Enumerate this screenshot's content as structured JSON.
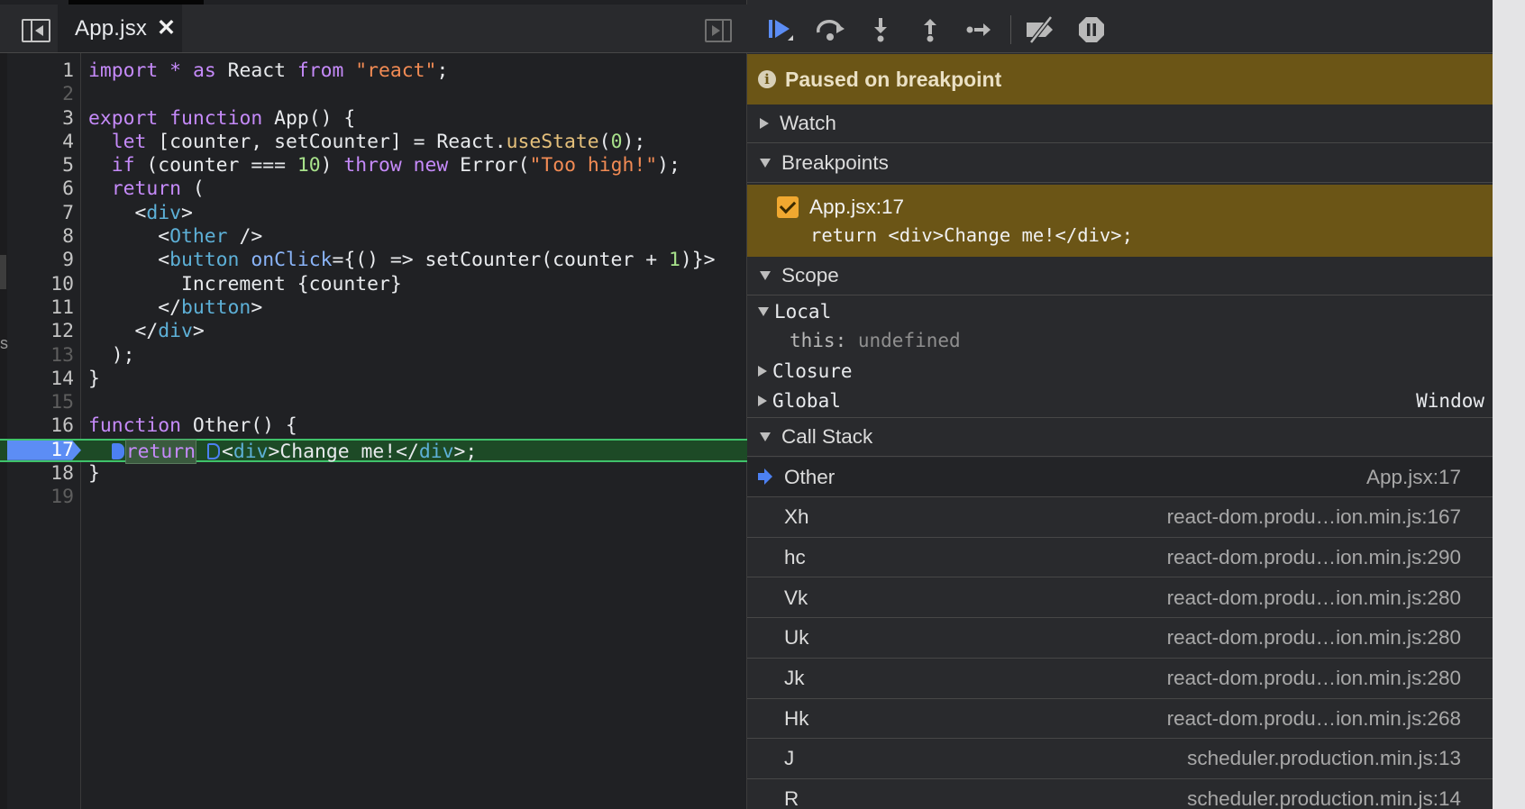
{
  "editor": {
    "active_tab": "App.jsx",
    "close_glyph": "✕",
    "lines": [
      {
        "n": "1",
        "html": "<span class=\"kw2\">import</span> <span class=\"kw2\">*</span> <span class=\"kw2\">as</span> React <span class=\"kw2\">from</span> <span class=\"str\">\"react\"</span>;"
      },
      {
        "n": "2",
        "html": ""
      },
      {
        "n": "3",
        "html": "<span class=\"kw2\">export</span> <span class=\"kw2\">function</span> App() {"
      },
      {
        "n": "4",
        "html": "  <span class=\"kw2\">let</span> [counter, setCounter] = React.<span class=\"fn-yellow\">useState</span>(<span class=\"num\">0</span>);"
      },
      {
        "n": "5",
        "html": "  <span class=\"kw2\">if</span> (counter === <span class=\"num\">10</span>) <span class=\"kw2\">throw</span> <span class=\"kw2\">new</span> Error(<span class=\"str\">\"Too high!\"</span>);"
      },
      {
        "n": "6",
        "html": "  <span class=\"kw2\">return</span> ("
      },
      {
        "n": "7",
        "html": "    &lt;<span class=\"tag\">div</span>&gt;"
      },
      {
        "n": "8",
        "html": "      &lt;<span class=\"tag\">Other</span> /&gt;"
      },
      {
        "n": "9",
        "html": "      &lt;<span class=\"tag\">button</span> <span class=\"attr\">onClick</span>={() =&gt; setCounter(counter + <span class=\"num\">1</span>)}&gt;"
      },
      {
        "n": "10",
        "html": "        Increment {counter}"
      },
      {
        "n": "11",
        "html": "      &lt;/<span class=\"tag\">button</span>&gt;"
      },
      {
        "n": "12",
        "html": "    &lt;/<span class=\"tag\">div</span>&gt;"
      },
      {
        "n": "13",
        "html": "  );"
      },
      {
        "n": "14",
        "html": "}"
      },
      {
        "n": "15",
        "html": ""
      },
      {
        "n": "16",
        "html": "<span class=\"kw2\">function</span> Other() {"
      },
      {
        "n": "17",
        "html": "  <span class=\"bp-marker solid\"></span><span class=\"kw2 pause-hl\">return</span> <span class=\"bp-marker hollow\"></span>&lt;<span class=\"tag\">div</span>&gt;Change me!&lt;/<span class=\"tag\">div</span>&gt;;"
      },
      {
        "n": "18",
        "html": "}"
      },
      {
        "n": "19",
        "html": ""
      }
    ],
    "active_line": "17",
    "dim_lines": [
      "2",
      "13",
      "15",
      "19"
    ]
  },
  "debugger": {
    "paused_message": "Paused on breakpoint",
    "sections": {
      "watch": "Watch",
      "breakpoints": "Breakpoints",
      "scope": "Scope",
      "call_stack": "Call Stack"
    },
    "breakpoint": {
      "location": "App.jsx:17",
      "source": "return <div>Change me!</div>;"
    },
    "scope": {
      "local": "Local",
      "this_label": "this:",
      "this_value": "undefined",
      "closure": "Closure",
      "global": "Global",
      "global_value": "Window"
    },
    "call_stack": [
      {
        "name": "Other",
        "location": "App.jsx:17"
      },
      {
        "name": "Xh",
        "location": "react-dom.produ…ion.min.js:167"
      },
      {
        "name": "hc",
        "location": "react-dom.produ…ion.min.js:290"
      },
      {
        "name": "Vk",
        "location": "react-dom.produ…ion.min.js:280"
      },
      {
        "name": "Uk",
        "location": "react-dom.produ…ion.min.js:280"
      },
      {
        "name": "Jk",
        "location": "react-dom.produ…ion.min.js:280"
      },
      {
        "name": "Hk",
        "location": "react-dom.produ…ion.min.js:268"
      },
      {
        "name": "J",
        "location": "scheduler.production.min.js:13"
      },
      {
        "name": "R",
        "location": "scheduler.production.min.js:14"
      }
    ]
  },
  "colors": {
    "paused_banner": "#6b5516",
    "execution_line": "#1d4a26",
    "execution_line_border": "#3fc26a",
    "breakpoint_blue": "#4c80f2",
    "checkbox": "#f0a830"
  },
  "icons": [
    "sidebar-toggle-icon",
    "close-icon",
    "panel-toggle-icon",
    "resume-icon",
    "step-over-icon",
    "step-into-icon",
    "step-out-icon",
    "step-icon",
    "deactivate-breakpoints-icon",
    "pause-on-exceptions-icon",
    "info-icon",
    "current-frame-arrow-icon"
  ]
}
